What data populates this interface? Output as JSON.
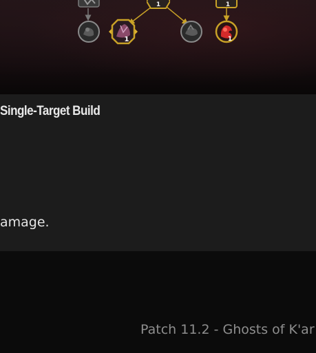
{
  "talent_tree": {
    "nodes": [
      {
        "name": "talent-node-upper-left",
        "state": "inactive"
      },
      {
        "name": "talent-node-upper-center",
        "state": "selected",
        "rank": "1"
      },
      {
        "name": "talent-node-upper-right",
        "state": "selected",
        "rank": "1"
      },
      {
        "name": "talent-node-left",
        "state": "inactive"
      },
      {
        "name": "talent-node-choice",
        "state": "selected",
        "rank": "1"
      },
      {
        "name": "talent-node-middle",
        "state": "inactive"
      },
      {
        "name": "talent-node-right",
        "state": "selected",
        "rank": "1"
      }
    ],
    "colors": {
      "gold": "#c9a227",
      "inactive": "#6a6a6a"
    }
  },
  "card": {
    "title": "Single-Target Build",
    "text": "amage."
  },
  "footer": {
    "patch": "Patch 11.2 - Ghosts of K'ar"
  }
}
